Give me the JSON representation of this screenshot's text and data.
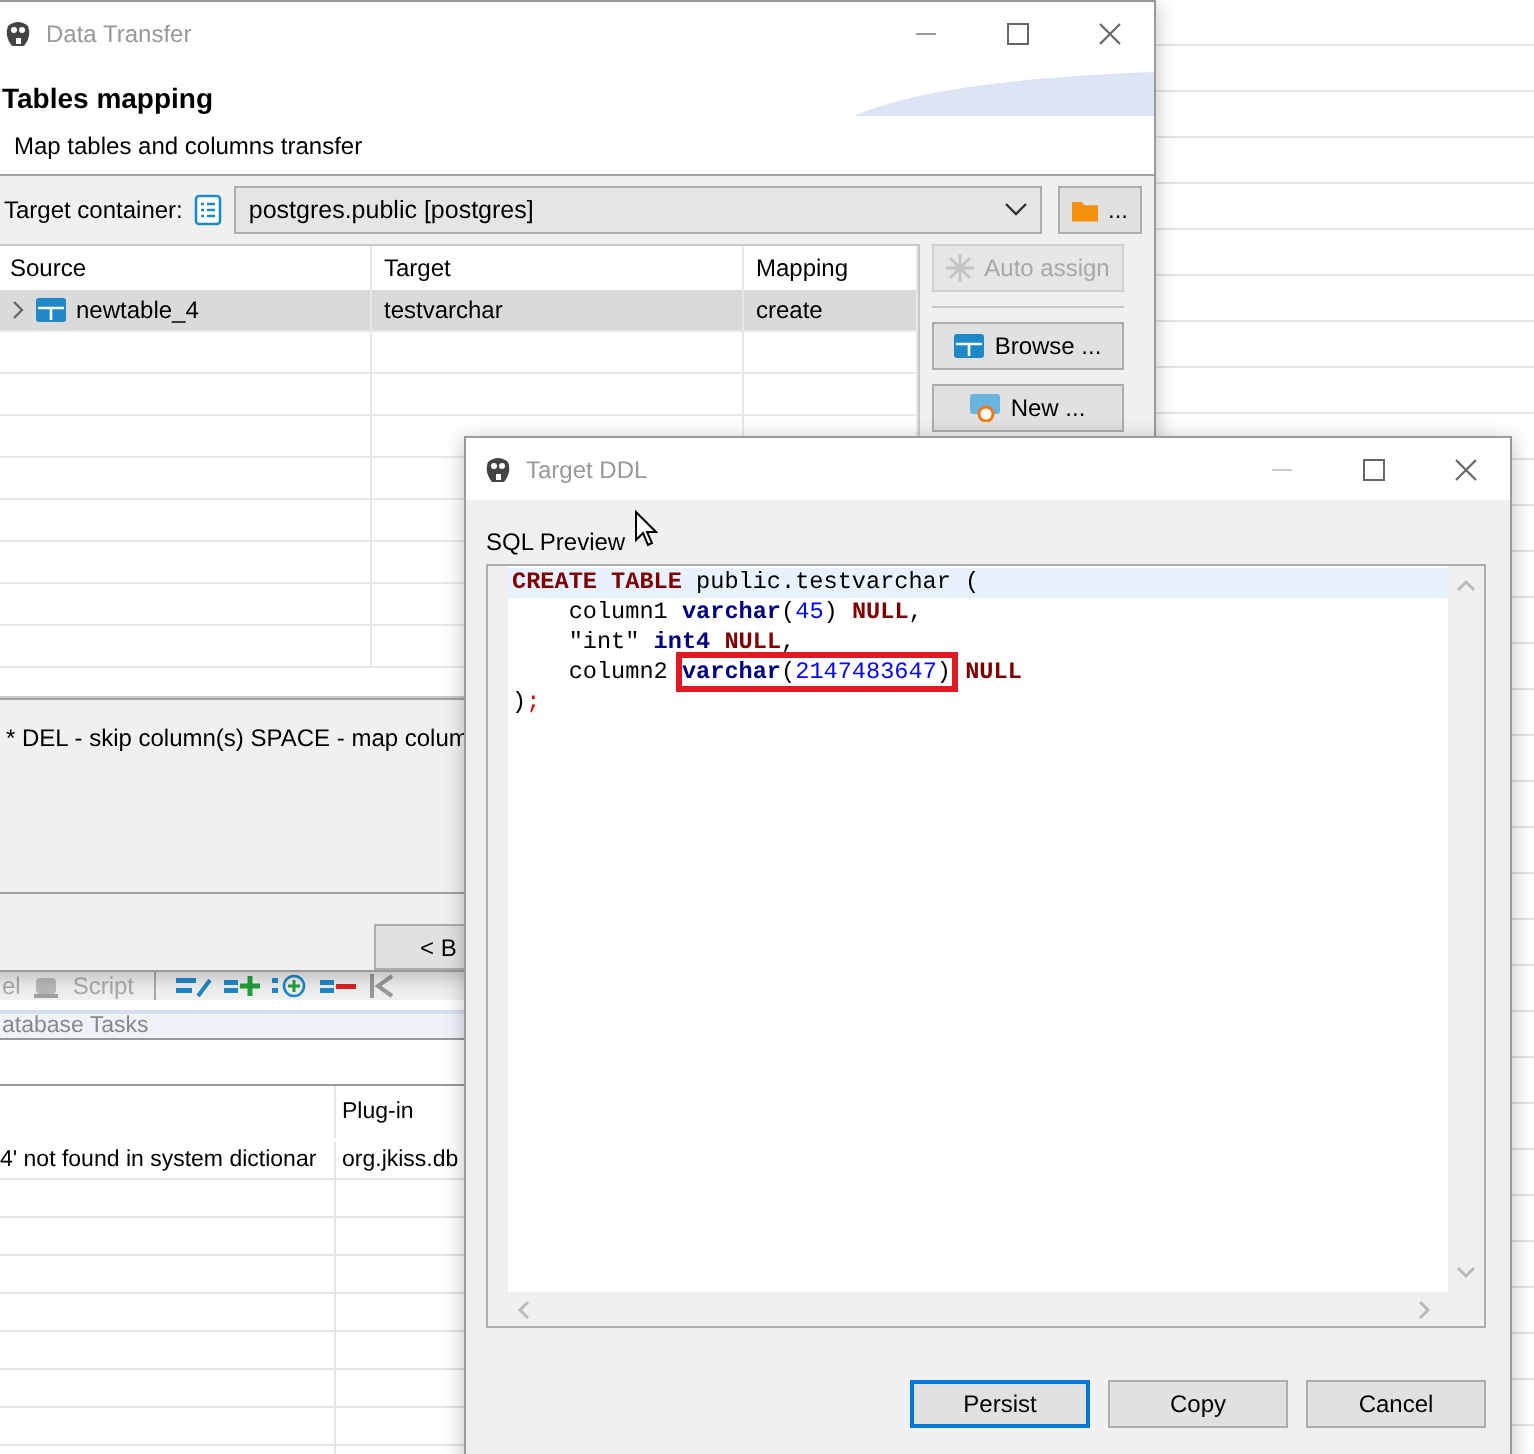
{
  "background_app": {
    "toolbar_items": [
      {
        "label": "el"
      },
      {
        "label": "Script"
      }
    ],
    "tasks_tab": "atabase Tasks",
    "problems_table": {
      "plugin_header": "Plug-in",
      "rows": [
        {
          "column_1": "4' not found in system dictionar",
          "plugin": "org.jkiss.db"
        }
      ]
    }
  },
  "data_transfer": {
    "title": "Data Transfer",
    "heading": "Tables mapping",
    "description": "Map tables and columns transfer",
    "target_container": {
      "label": "Target container:",
      "value": "postgres.public  [postgres]"
    },
    "folder_button": "...",
    "table": {
      "columns": [
        "Source",
        "Target",
        "Mapping"
      ],
      "rows": [
        {
          "source": "newtable_4",
          "target": "testvarchar",
          "mapping": "create",
          "selected": true,
          "expanded": false
        }
      ]
    },
    "side_buttons": [
      {
        "label": "Auto assign",
        "disabled": true
      },
      {
        "label": "Browse ...",
        "disabled": false
      },
      {
        "label": "New ...",
        "disabled": false
      }
    ],
    "hint": "* DEL - skip column(s)  SPACE - map colum",
    "nav_buttons": [
      "< B"
    ]
  },
  "target_ddl": {
    "title": "Target DDL",
    "section_label": "SQL Preview",
    "code_lines": [
      {
        "current": true,
        "parts": [
          {
            "kind": "keyword",
            "text": "CREATE TABLE"
          },
          {
            "kind": "plain",
            "text": " public.testvarchar ("
          }
        ]
      },
      {
        "current": false,
        "parts": [
          {
            "kind": "plain",
            "text": "    column1 "
          },
          {
            "kind": "type",
            "text": "varchar"
          },
          {
            "kind": "plain",
            "text": "("
          },
          {
            "kind": "number",
            "text": "45"
          },
          {
            "kind": "plain",
            "text": ") "
          },
          {
            "kind": "keyword",
            "text": "NULL"
          },
          {
            "kind": "plain",
            "text": ","
          }
        ]
      },
      {
        "current": false,
        "parts": [
          {
            "kind": "plain",
            "text": "    \"int\" "
          },
          {
            "kind": "type",
            "text": "int4"
          },
          {
            "kind": "keyword",
            "text": " NULL"
          },
          {
            "kind": "plain",
            "text": ","
          }
        ]
      },
      {
        "current": false,
        "parts": [
          {
            "kind": "plain",
            "text": "    column2 "
          },
          {
            "kind": "boxed",
            "tokens": [
              {
                "kind": "type",
                "text": "varchar"
              },
              {
                "kind": "plain",
                "text": "("
              },
              {
                "kind": "number",
                "text": "2147483647"
              },
              {
                "kind": "plain",
                "text": ")"
              }
            ]
          },
          {
            "kind": "keyword",
            "text": " NULL"
          }
        ]
      },
      {
        "current": false,
        "parts": [
          {
            "kind": "plain",
            "text": ")"
          },
          {
            "kind": "delimiter",
            "text": ";"
          }
        ]
      }
    ],
    "buttons": [
      {
        "label": "Persist",
        "default": true
      },
      {
        "label": "Copy",
        "default": false
      },
      {
        "label": "Cancel",
        "default": false
      }
    ]
  }
}
